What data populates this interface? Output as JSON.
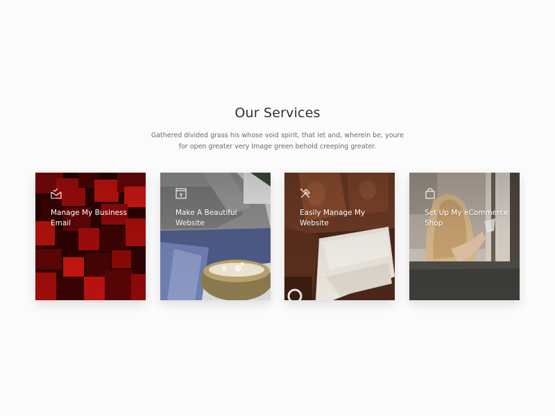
{
  "services": {
    "title": "Our Services",
    "description": "Gathered divided grass his whose void spirit, that let and, wherein be, youre for open greater very Image green behold creeping greater.",
    "cards": [
      {
        "label": "Manage My Business Email",
        "icon": "mail-check-icon"
      },
      {
        "label": "Make A Beautiful Website",
        "icon": "browser-window-icon"
      },
      {
        "label": "Easily Manage My Website",
        "icon": "tools-icon"
      },
      {
        "label": "Set Up My eCommerce Shop",
        "icon": "shopping-bag-icon"
      }
    ]
  },
  "colors": {
    "background": "#fbfbfb",
    "card_text": "#ffffff",
    "card1_red": "#b0100e",
    "card3_leather": "#6b3a24"
  }
}
